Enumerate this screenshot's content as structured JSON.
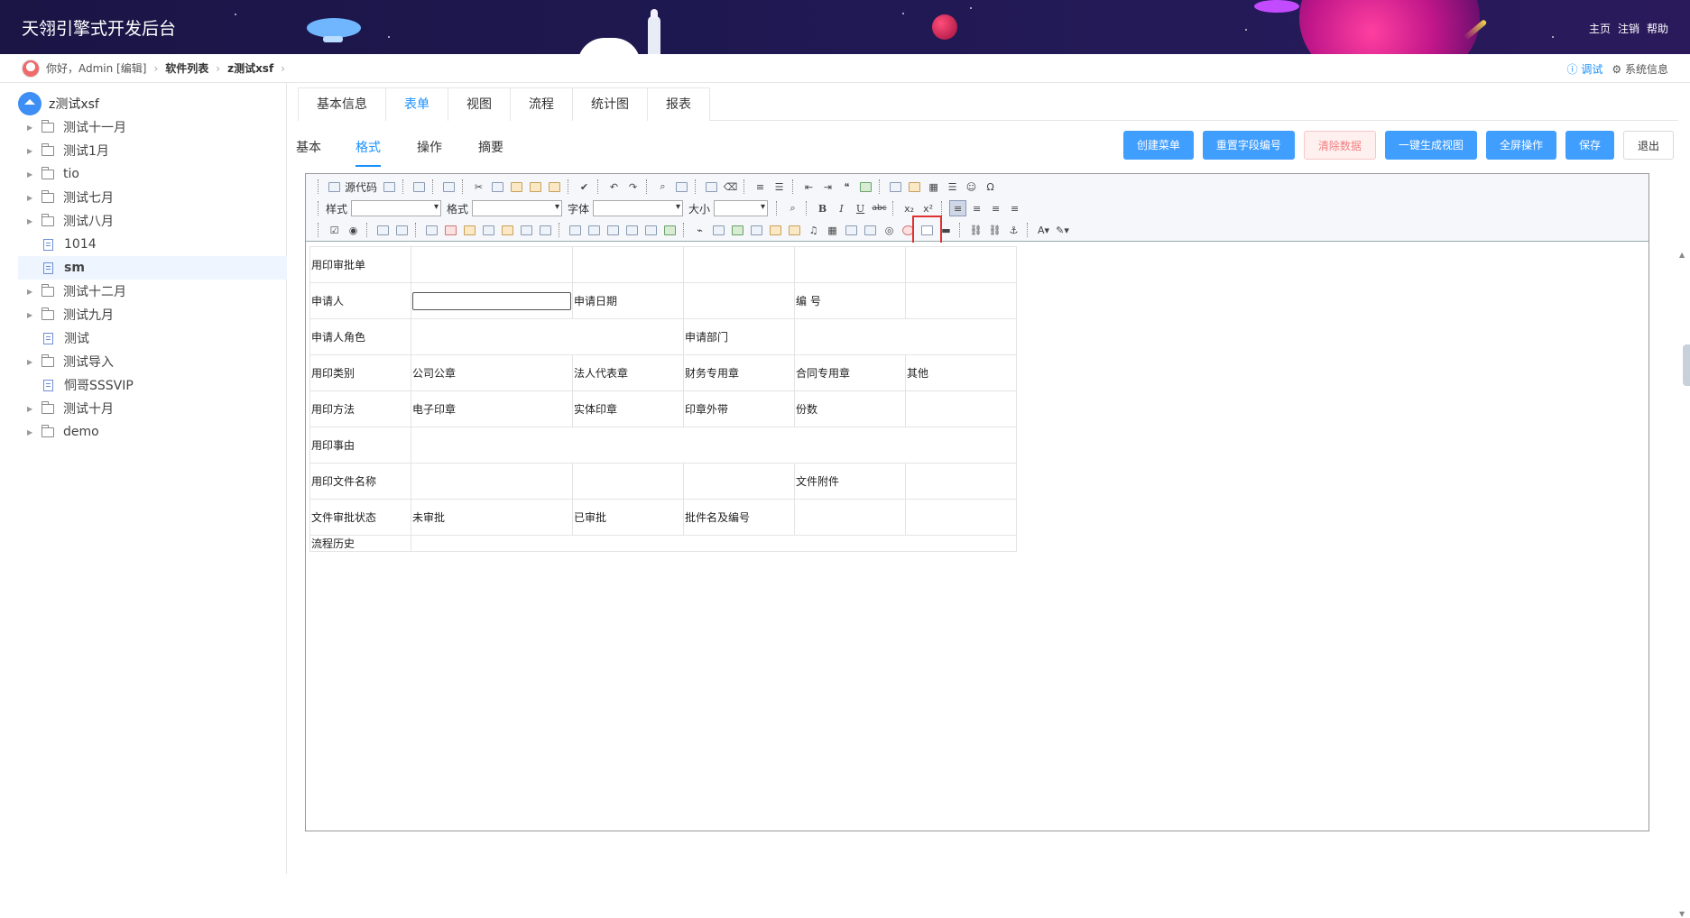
{
  "header": {
    "title": "天翎引擎式开发后台",
    "links": [
      "主页",
      "注销",
      "帮助"
    ]
  },
  "breadcrumb": {
    "greeting": "你好，Admin [编辑]",
    "items": [
      "软件列表",
      "z测试xsf"
    ],
    "debug_label": "调试",
    "sysinfo_label": "系统信息"
  },
  "sidebar": {
    "root": "z测试xsf",
    "items": [
      {
        "label": "测试十一月",
        "type": "folder"
      },
      {
        "label": "测试1月",
        "type": "folder"
      },
      {
        "label": "tio",
        "type": "folder"
      },
      {
        "label": "测试七月",
        "type": "folder"
      },
      {
        "label": "测试八月",
        "type": "folder"
      },
      {
        "label": "1014",
        "type": "file"
      },
      {
        "label": "sm",
        "type": "file"
      },
      {
        "label": "测试十二月",
        "type": "folder"
      },
      {
        "label": "测试九月",
        "type": "folder"
      },
      {
        "label": "测试",
        "type": "file"
      },
      {
        "label": "测试导入",
        "type": "folder"
      },
      {
        "label": "恫哥SSSVIP",
        "type": "file"
      },
      {
        "label": "测试十月",
        "type": "folder"
      },
      {
        "label": "demo",
        "type": "folder"
      }
    ]
  },
  "main": {
    "tabs": [
      "基本信息",
      "表单",
      "视图",
      "流程",
      "统计图",
      "报表"
    ],
    "subtabs": [
      "基本",
      "格式",
      "操作",
      "摘要"
    ],
    "buttons": {
      "create_menu": "创建菜单",
      "reset_field": "重置字段编号",
      "clear_data": "清除数据",
      "gen_view": "一键生成视图",
      "fullscreen": "全屏操作",
      "save": "保存",
      "exit": "退出"
    }
  },
  "toolbar": {
    "source": "源代码",
    "style": "样式",
    "format": "格式",
    "font": "字体",
    "size": "大小",
    "bold": "B",
    "italic": "I",
    "underline": "U",
    "strike": "abc",
    "sub": "x₂",
    "sup": "x²",
    "omega": "Ω"
  },
  "form": {
    "title": "用印审批单",
    "applicant": "申请人",
    "apply_date": "申请日期",
    "number": "编  号",
    "role": "申请人角色",
    "dept": "申请部门",
    "seal_type": "用印类别",
    "seal_types": [
      "公司公章",
      "法人代表章",
      "财务专用章",
      "合同专用章",
      "其他"
    ],
    "method": "用印方法",
    "methods": [
      "电子印章",
      "实体印章",
      "印章外带"
    ],
    "copies": "份数",
    "reason": "用印事由",
    "doc_name": "用印文件名称",
    "attachment": "文件附件",
    "status": "文件审批状态",
    "unapproved": "未审批",
    "approved": "已审批",
    "approval_no": "批件名及编号",
    "history": "流程历史"
  },
  "colors": {
    "accent": "#409eff",
    "header_bg": "#1e1850",
    "highlight": "#e03030"
  }
}
